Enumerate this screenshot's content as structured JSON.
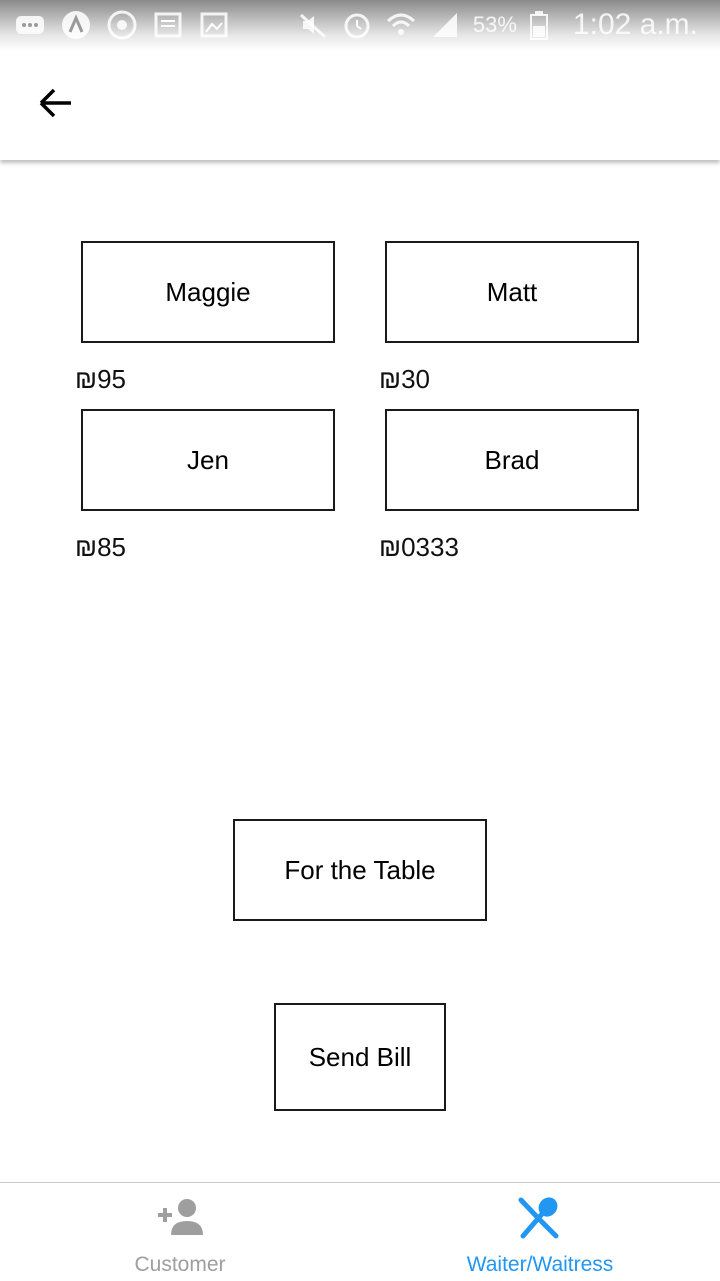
{
  "status_bar": {
    "battery": "53%",
    "time": "1:02 a.m."
  },
  "people": [
    {
      "name": "Maggie",
      "amount": "₪95"
    },
    {
      "name": "Matt",
      "amount": "₪30"
    },
    {
      "name": "Jen",
      "amount": "₪85"
    },
    {
      "name": "Brad",
      "amount": "₪0333"
    }
  ],
  "actions": {
    "for_table": "For the Table",
    "send_bill": "Send Bill"
  },
  "bottom_nav": {
    "items": [
      {
        "label": "Customer",
        "icon": "add-person-icon",
        "active": false
      },
      {
        "label": "Waiter/Waitress",
        "icon": "spoon-knife-icon",
        "active": true
      }
    ],
    "active_color": "#2196F3",
    "inactive_color": "#9e9e9e"
  }
}
